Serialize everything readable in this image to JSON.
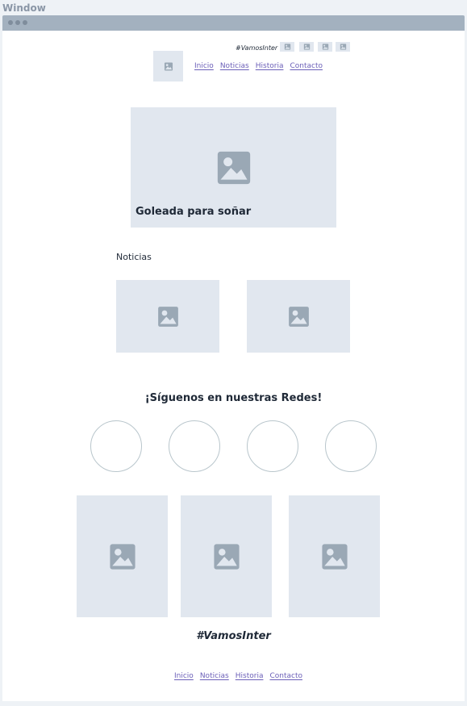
{
  "window": {
    "title": "Window"
  },
  "header": {
    "hashtag": "#VamosInter",
    "social_icons": [
      "image-icon",
      "image-icon",
      "image-icon",
      "image-icon"
    ],
    "nav": [
      "Inicio",
      "Noticias",
      "Historia",
      "Contacto"
    ]
  },
  "hero": {
    "title": "Goleada para soñar"
  },
  "news": {
    "label": "Noticias"
  },
  "social": {
    "title": "¡Síguenos en nuestras Redes!"
  },
  "footer": {
    "hashtag": "#VamosInter",
    "nav": [
      "Inicio",
      "Noticias",
      "Historia",
      "Contacto"
    ]
  },
  "colors": {
    "placeholder": "#e1e7ef",
    "icon": "#9aa8b5",
    "link": "#6b5fb8",
    "window_bar": "#a3b1bf"
  }
}
